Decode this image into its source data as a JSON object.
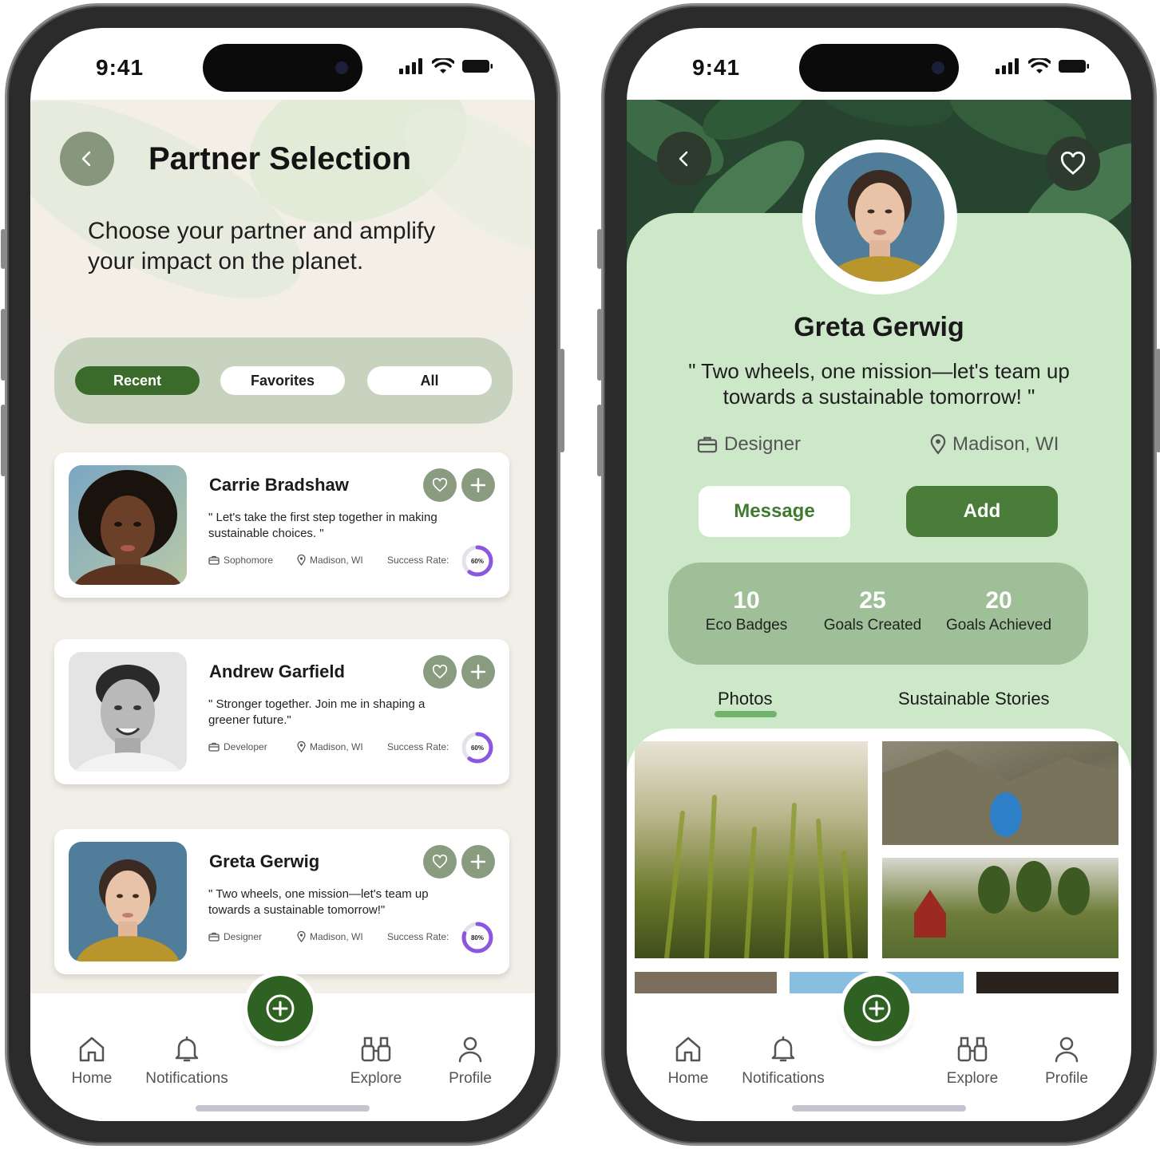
{
  "status": {
    "time": "9:41"
  },
  "left": {
    "title": "Partner Selection",
    "subtitle": "Choose your partner and amplify your impact on the planet.",
    "tabs": [
      "Recent",
      "Favorites",
      "All"
    ],
    "success_label": "Success Rate:",
    "cards": [
      {
        "name": "Carrie Bradshaw",
        "quote": "\" Let's take the first step together in making sustainable choices. \"",
        "role": "Sophomore",
        "location": "Madison, WI",
        "rate": "60%",
        "rate_value": 0.6
      },
      {
        "name": "Andrew Garfield",
        "quote": "\" Stronger together. Join me in shaping a greener future.\"",
        "role": "Developer",
        "location": "Madison, WI",
        "rate": "60%",
        "rate_value": 0.6
      },
      {
        "name": "Greta Gerwig",
        "quote": "\" Two wheels, one mission—let's team up towards a sustainable tomorrow!\"",
        "role": "Designer",
        "location": "Madison, WI",
        "rate": "80%",
        "rate_value": 0.8
      }
    ]
  },
  "right": {
    "name": "Greta Gerwig",
    "quote": "\" Two wheels, one mission—let's team up towards a sustainable tomorrow! \"",
    "role": "Designer",
    "location": "Madison, WI",
    "message_label": "Message",
    "add_label": "Add",
    "stats": [
      {
        "value": "10",
        "label": "Eco Badges"
      },
      {
        "value": "25",
        "label": "Goals Created"
      },
      {
        "value": "20",
        "label": "Goals Achieved"
      }
    ],
    "tabs": [
      "Photos",
      "Sustainable Stories"
    ]
  },
  "nav": [
    "Home",
    "Notifications",
    "Explore",
    "Profile"
  ],
  "colors": {
    "primary": "#3a6b2a",
    "panel": "#cde8c9",
    "accent": "#4a7c3a"
  },
  "icons": [
    "back-icon",
    "heart-icon",
    "plus-icon",
    "briefcase-icon",
    "location-pin-icon",
    "home-icon",
    "bell-icon",
    "binoculars-icon",
    "user-icon",
    "add-circle-icon"
  ]
}
